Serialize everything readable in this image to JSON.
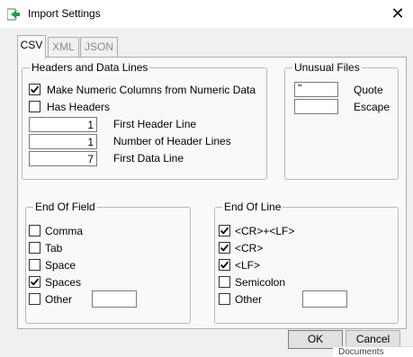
{
  "window": {
    "title": "Import Settings",
    "close_glyph": "✕"
  },
  "tabs": [
    {
      "label": "CSV",
      "active": true
    },
    {
      "label": "XML",
      "active": false
    },
    {
      "label": "JSON",
      "active": false
    }
  ],
  "headers_group": {
    "legend": "Headers and Data Lines",
    "make_numeric": {
      "label": "Make Numeric Columns from Numeric Data",
      "checked": true
    },
    "has_headers": {
      "label": "Has Headers",
      "checked": false
    },
    "fields": [
      {
        "value": "1",
        "label": "First Header Line"
      },
      {
        "value": "1",
        "label": "Number of Header Lines"
      },
      {
        "value": "7",
        "label": "First Data Line"
      }
    ]
  },
  "unusual_group": {
    "legend": "Unusual Files",
    "quote": {
      "value": "\"",
      "label": "Quote"
    },
    "escape": {
      "value": "",
      "label": "Escape"
    }
  },
  "end_of_field": {
    "legend": "End Of Field",
    "items": [
      {
        "label": "Comma",
        "checked": false
      },
      {
        "label": "Tab",
        "checked": false
      },
      {
        "label": "Space",
        "checked": false
      },
      {
        "label": "Spaces",
        "checked": true
      },
      {
        "label": "Other",
        "checked": false
      }
    ],
    "other_value": ""
  },
  "end_of_line": {
    "legend": "End Of Line",
    "items": [
      {
        "label": "<CR>+<LF>",
        "checked": true
      },
      {
        "label": "<CR>",
        "checked": true
      },
      {
        "label": "<LF>",
        "checked": true
      },
      {
        "label": "Semicolon",
        "checked": false
      },
      {
        "label": "Other",
        "checked": false
      }
    ],
    "other_value": ""
  },
  "buttons": {
    "ok": "OK",
    "cancel": "Cancel"
  },
  "background_peek": "Documents",
  "icons": {
    "app": "import-arrow-icon",
    "check": "checkmark-icon",
    "close": "close-icon"
  }
}
